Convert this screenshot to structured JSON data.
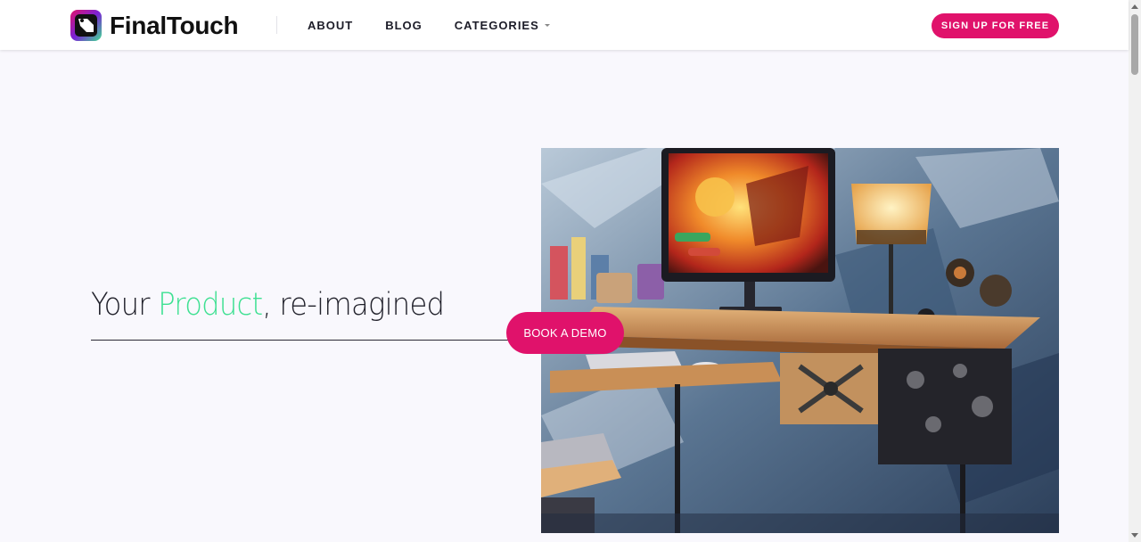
{
  "header": {
    "logo_text": "FinalTouch",
    "logo_icon": "finaltouch-logo-icon",
    "nav": [
      {
        "label": "ABOUT"
      },
      {
        "label": "BLOG"
      },
      {
        "label": "CATEGORIES",
        "has_dropdown": true
      }
    ],
    "signup_label": "SIGN UP FOR FREE"
  },
  "hero": {
    "title_prefix": "Your ",
    "title_accent": "Product",
    "title_suffix": ", re-imagined",
    "cta_label": "BOOK A DEMO",
    "image": "desk-setup-illustration"
  },
  "colors": {
    "brand": "#e0126b",
    "accent_green": "#3ee092",
    "background": "#f9f8fd",
    "text": "#22222c"
  }
}
